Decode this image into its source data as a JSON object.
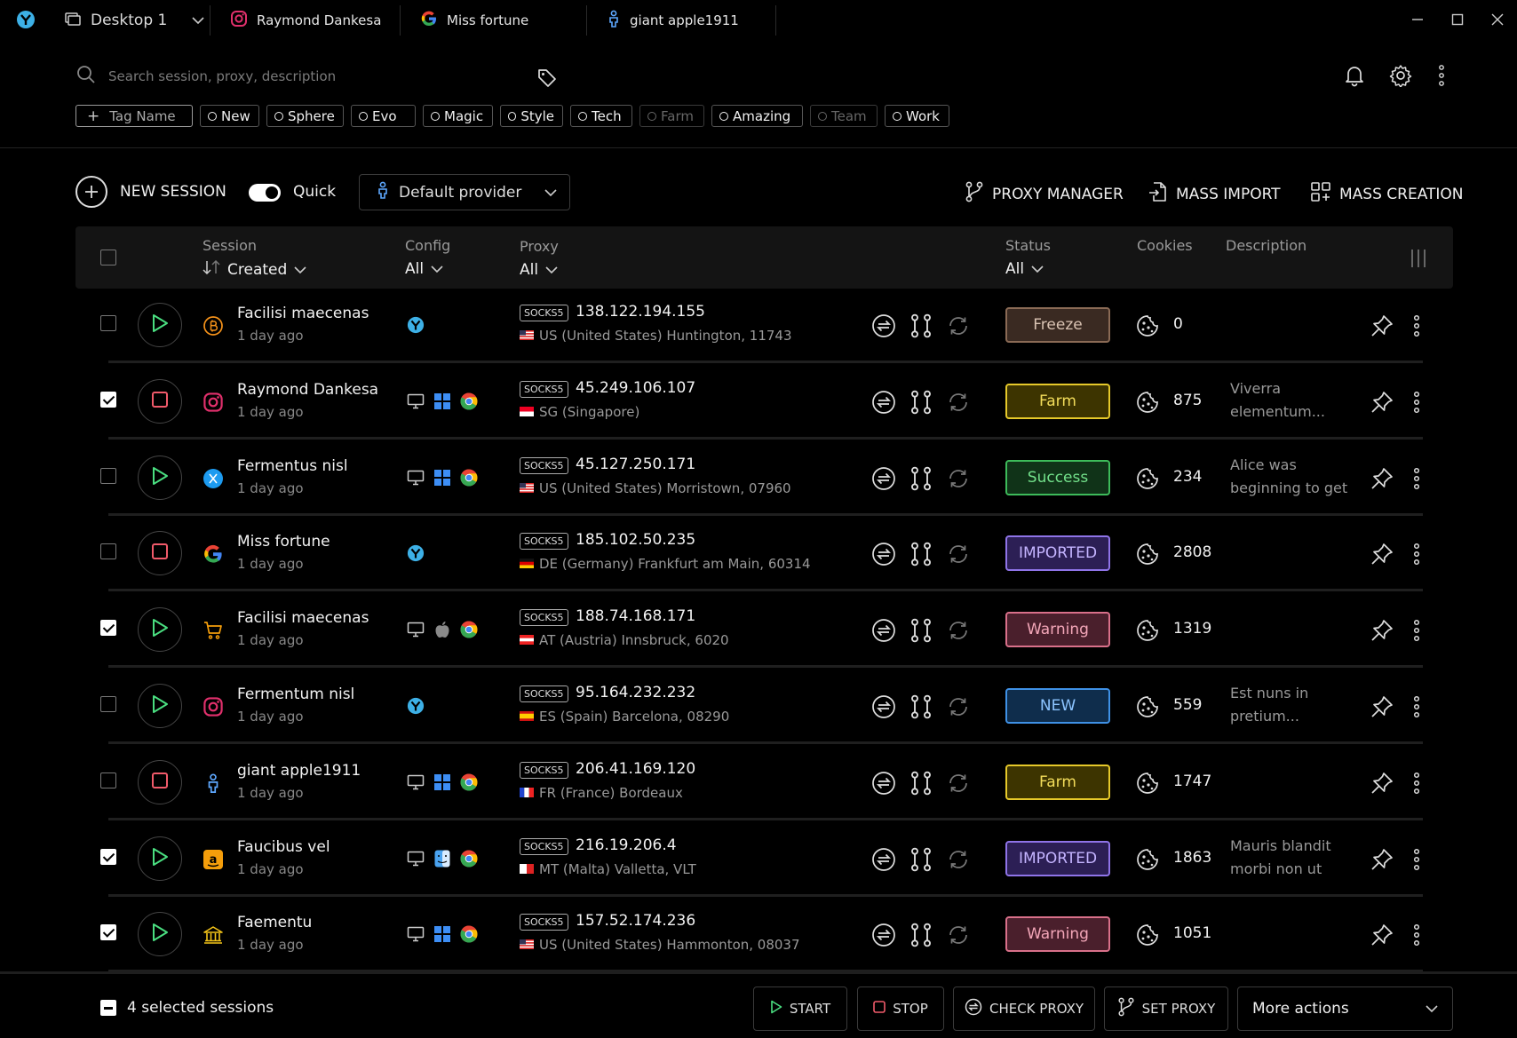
{
  "titlebar": {
    "desktop_label": "Desktop 1",
    "tabs": [
      {
        "label": "Raymond Dankesa",
        "icon": "instagram-icon"
      },
      {
        "label": "Miss fortune",
        "icon": "google-icon"
      },
      {
        "label": "giant apple1911",
        "icon": "person-icon"
      }
    ]
  },
  "search": {
    "placeholder": "Search session, proxy, description"
  },
  "tags": {
    "add_label": "Tag Name",
    "items": [
      {
        "label": "New",
        "dim": false
      },
      {
        "label": "Sphere",
        "dim": false
      },
      {
        "label": "Evo",
        "dim": false
      },
      {
        "label": "Magic",
        "dim": false
      },
      {
        "label": "Style",
        "dim": false
      },
      {
        "label": "Tech",
        "dim": false
      },
      {
        "label": "Farm",
        "dim": true
      },
      {
        "label": "Amazing",
        "dim": false
      },
      {
        "label": "Team",
        "dim": true
      },
      {
        "label": "Work",
        "dim": false
      }
    ]
  },
  "toolbar": {
    "new_session": "NEW SESSION",
    "quick": "Quick",
    "provider": "Default provider",
    "proxy_manager": "PROXY MANAGER",
    "mass_import": "MASS IMPORT",
    "mass_creation": "MASS CREATION"
  },
  "table": {
    "headers": {
      "session": "Session",
      "session_sort": "Created",
      "config": "Config",
      "config_filter": "All",
      "proxy": "Proxy",
      "proxy_filter": "All",
      "status": "Status",
      "status_filter": "All",
      "cookies": "Cookies",
      "description": "Description"
    },
    "proxy_type": "SOCKS5",
    "rows": [
      {
        "checked": false,
        "running": false,
        "icon": "bitcoin-icon",
        "name": "Facilisi maecenas",
        "time": "1 day ago",
        "config": "browser",
        "ip": "138.122.194.155",
        "flag": "us",
        "location": "US (United States) Huntington, 11743",
        "status": "Freeze",
        "cookies": "0",
        "description": ""
      },
      {
        "checked": true,
        "running": true,
        "icon": "instagram-icon",
        "name": "Raymond Dankesa",
        "time": "1 day ago",
        "config": "windows",
        "ip": "45.249.106.107",
        "flag": "sg",
        "location": "SG (Singapore)",
        "status": "Farm",
        "cookies": "875",
        "description": "Viverra elementum..."
      },
      {
        "checked": false,
        "running": false,
        "icon": "twitter-icon",
        "name": "Fermentus nisl",
        "time": "1 day ago",
        "config": "windows",
        "ip": "45.127.250.171",
        "flag": "us",
        "location": "US (United States) Morristown, 07960",
        "status": "Success",
        "cookies": "234",
        "description": "Alice was beginning to get"
      },
      {
        "checked": false,
        "running": true,
        "icon": "google-icon",
        "name": "Miss fortune",
        "time": "1 day ago",
        "config": "browser",
        "ip": "185.102.50.235",
        "flag": "de",
        "location": "DE (Germany) Frankfurt am Main, 60314",
        "status": "IMPORTED",
        "cookies": "2808",
        "description": ""
      },
      {
        "checked": true,
        "running": false,
        "icon": "cart-icon",
        "name": "Facilisi maecenas",
        "time": "1 day ago",
        "config": "apple",
        "ip": "188.74.168.171",
        "flag": "at",
        "location": "AT (Austria) Innsbruck, 6020",
        "status": "Warning",
        "cookies": "1319",
        "description": ""
      },
      {
        "checked": false,
        "running": false,
        "icon": "instagram-icon",
        "name": "Fermentum nisl",
        "time": "1 day ago",
        "config": "browser",
        "ip": "95.164.232.232",
        "flag": "es",
        "location": "ES (Spain) Barcelona, 08290",
        "status": "NEW",
        "cookies": "559",
        "description": "Est nuns in pretium..."
      },
      {
        "checked": false,
        "running": true,
        "icon": "person-icon",
        "name": "giant apple1911",
        "time": "1 day ago",
        "config": "windows",
        "ip": "206.41.169.120",
        "flag": "fr",
        "location": "FR (France) Bordeaux",
        "status": "Farm",
        "cookies": "1747",
        "description": ""
      },
      {
        "checked": true,
        "running": false,
        "icon": "amazon-icon",
        "name": "Faucibus vel",
        "time": "1 day ago",
        "config": "finder",
        "ip": "216.19.206.4",
        "flag": "mt",
        "location": "MT (Malta) Valletta, VLT",
        "status": "IMPORTED",
        "cookies": "1863",
        "description": "Mauris blandit morbi non ut"
      },
      {
        "checked": true,
        "running": false,
        "icon": "bank-icon",
        "name": "Faementu",
        "time": "1 day ago",
        "config": "windows",
        "ip": "157.52.174.236",
        "flag": "us",
        "location": "US (United States) Hammonton, 08037",
        "status": "Warning",
        "cookies": "1051",
        "description": ""
      }
    ]
  },
  "status_colors": {
    "Freeze": {
      "bg": "#3a2a22",
      "border": "#8a6a55",
      "text": "#d9c3b3"
    },
    "Farm": {
      "bg": "#3d3400",
      "border": "#e6c92a",
      "text": "#f2dc5a"
    },
    "Success": {
      "bg": "#103318",
      "border": "#3dbb5a",
      "text": "#72e08a"
    },
    "IMPORTED": {
      "bg": "#2c1f55",
      "border": "#8f74e8",
      "text": "#c4b4ff"
    },
    "Warning": {
      "bg": "#4a1f2c",
      "border": "#d9708a",
      "text": "#f3a6b8"
    },
    "NEW": {
      "bg": "#0f2d4c",
      "border": "#3f91e6",
      "text": "#8cc4ff"
    }
  },
  "bottom": {
    "selected": "4 selected sessions",
    "start": "START",
    "stop": "STOP",
    "check_proxy": "CHECK PROXY",
    "set_proxy": "SET PROXY",
    "more_actions": "More actions"
  }
}
